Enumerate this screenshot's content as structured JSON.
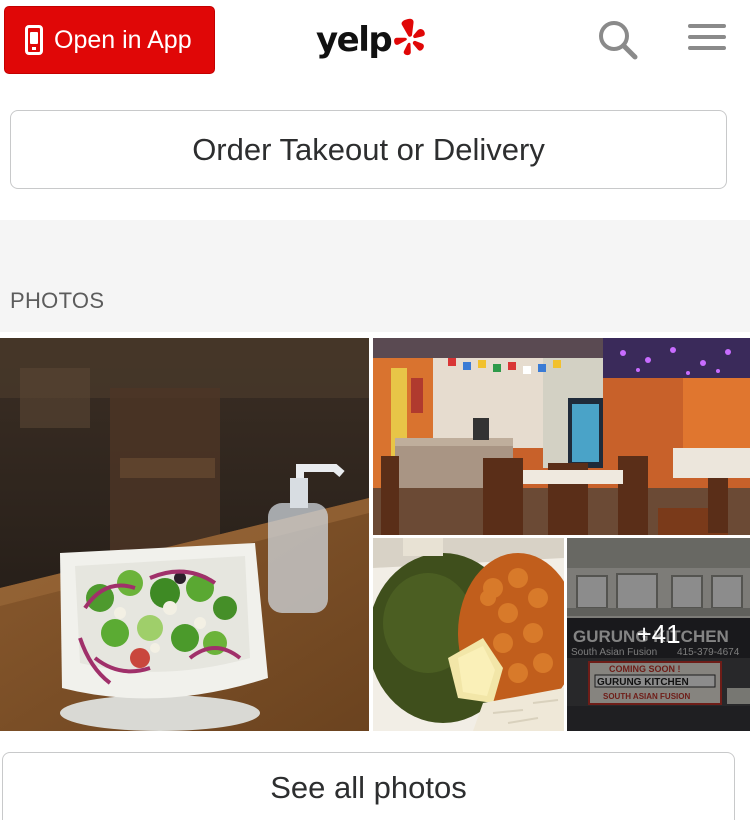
{
  "header": {
    "open_app_label": "Open in App",
    "logo_text": "yelp",
    "brand_color": "#e00707"
  },
  "order_button_label": "Order Takeout or Delivery",
  "photos": {
    "section_label": "PHOTOS",
    "more_count_label": "+41",
    "sign_text": {
      "main_sign": "GURUNG KITCHEN",
      "subtitle": "South Asian Fusion",
      "phone": "415-379-4674",
      "coming_soon": "COMING SOON !",
      "banner_name": "GURUNG KITCHEN",
      "banner_sub": "SOUTH ASIAN FUSION"
    }
  },
  "see_all_label": "See all photos"
}
